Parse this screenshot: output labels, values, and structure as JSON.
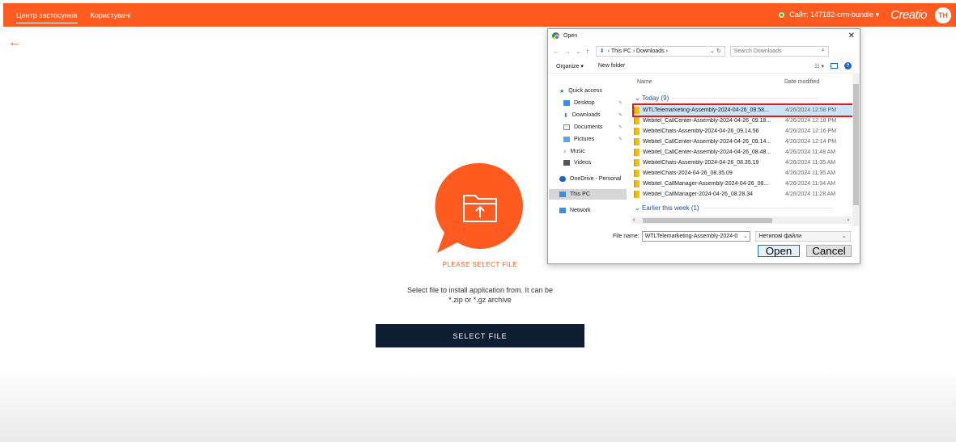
{
  "topbar": {
    "tabs": [
      {
        "label": "Центр застосунків",
        "active": true
      },
      {
        "label": "Користувачі",
        "active": false
      }
    ],
    "site_label": "Сайт: 147182-crm-bundle",
    "site_caret": "▾",
    "brand": "Creatio",
    "avatar_initials": "TH"
  },
  "back_icon": "←",
  "upload": {
    "heading": "PLEASE SELECT FILE",
    "hint": "Select file to install application from. It can be *.zip or *.gz archive",
    "button_label": "SELECT FILE"
  },
  "dialog": {
    "title": "Open",
    "close_glyph": "✕",
    "nav": {
      "back": "←",
      "forward": "→",
      "down": "⌄",
      "up": "↑"
    },
    "address": {
      "path_1": "This PC",
      "sep": "›",
      "path_2": "Downloads",
      "path_end": "⌄  ↻"
    },
    "search_placeholder": "Search Downloads",
    "toolbar": {
      "organize": "Organize ▾",
      "new_folder": "New folder",
      "view": "☷ ▾",
      "help": "?"
    },
    "left_pane": [
      {
        "label": "Quick access",
        "icon": "star-icon",
        "pinned": false
      },
      {
        "label": "Desktop",
        "icon": "desktop-icon",
        "pinned": true
      },
      {
        "label": "Downloads",
        "icon": "download-icon",
        "pinned": true
      },
      {
        "label": "Documents",
        "icon": "documents-icon",
        "pinned": true
      },
      {
        "label": "Pictures",
        "icon": "pictures-icon",
        "pinned": true
      },
      {
        "label": "Music",
        "icon": "music-icon",
        "pinned": false
      },
      {
        "label": "Videos",
        "icon": "videos-icon",
        "pinned": false
      },
      {
        "label": "OneDrive - Personal",
        "icon": "cloud-icon",
        "pinned": false
      },
      {
        "label": "This PC",
        "icon": "pc-icon",
        "pinned": false,
        "selected": true
      },
      {
        "label": "Network",
        "icon": "network-icon",
        "pinned": false
      }
    ],
    "pin_glyph": "📌",
    "columns": {
      "name": "Name",
      "date": "Date modified"
    },
    "groups": {
      "today": "Today (9)",
      "earlier": "Earlier this week (1)"
    },
    "files": [
      {
        "name": "WTLTelemarketing-Assembly-2024-04-26_09.58...",
        "date": "4/26/2024 12:58 PM",
        "highlight": true
      },
      {
        "name": "Webitel_CallCenter-Assembly-2024-04-26_09.18...",
        "date": "4/26/2024 12:18 PM"
      },
      {
        "name": "WebitelChats-Assembly-2024-04-26_09.14.56",
        "date": "4/26/2024 12:16 PM"
      },
      {
        "name": "Webitel_CallCenter-Assembly-2024-04-26_09.14...",
        "date": "4/26/2024 12:14 PM"
      },
      {
        "name": "Webitel_CallCenter-Assembly-2024-04-26_08.48...",
        "date": "4/26/2024 11:48 AM"
      },
      {
        "name": "WebitelChats-Assembly-2024-04-26_08.35.19",
        "date": "4/26/2024 11:35 AM"
      },
      {
        "name": "WebitelChats-2024-04-26_08.35.09",
        "date": "4/26/2024 11:35 AM"
      },
      {
        "name": "Webitel_CallManager-Assembly-2024-04-26_08...",
        "date": "4/26/2024 11:34 AM"
      },
      {
        "name": "Webitel_CallManager-2024-04-26_08.28.34",
        "date": "4/26/2024 11:28 AM"
      }
    ],
    "hscroll": {
      "left": "‹",
      "right": "›"
    },
    "file_name_label": "File name:",
    "file_name_value": "WTLTelemarketing-Assembly-2024-0",
    "file_name_caret": "⌄",
    "file_type_value": "Нетипові файли",
    "file_type_caret": "⌄",
    "open_label": "Open",
    "cancel_label": "Cancel"
  },
  "colors": {
    "accent": "#ff5a1f",
    "button_dark": "#0e1f35",
    "highlight_border": "#e01b1b"
  }
}
